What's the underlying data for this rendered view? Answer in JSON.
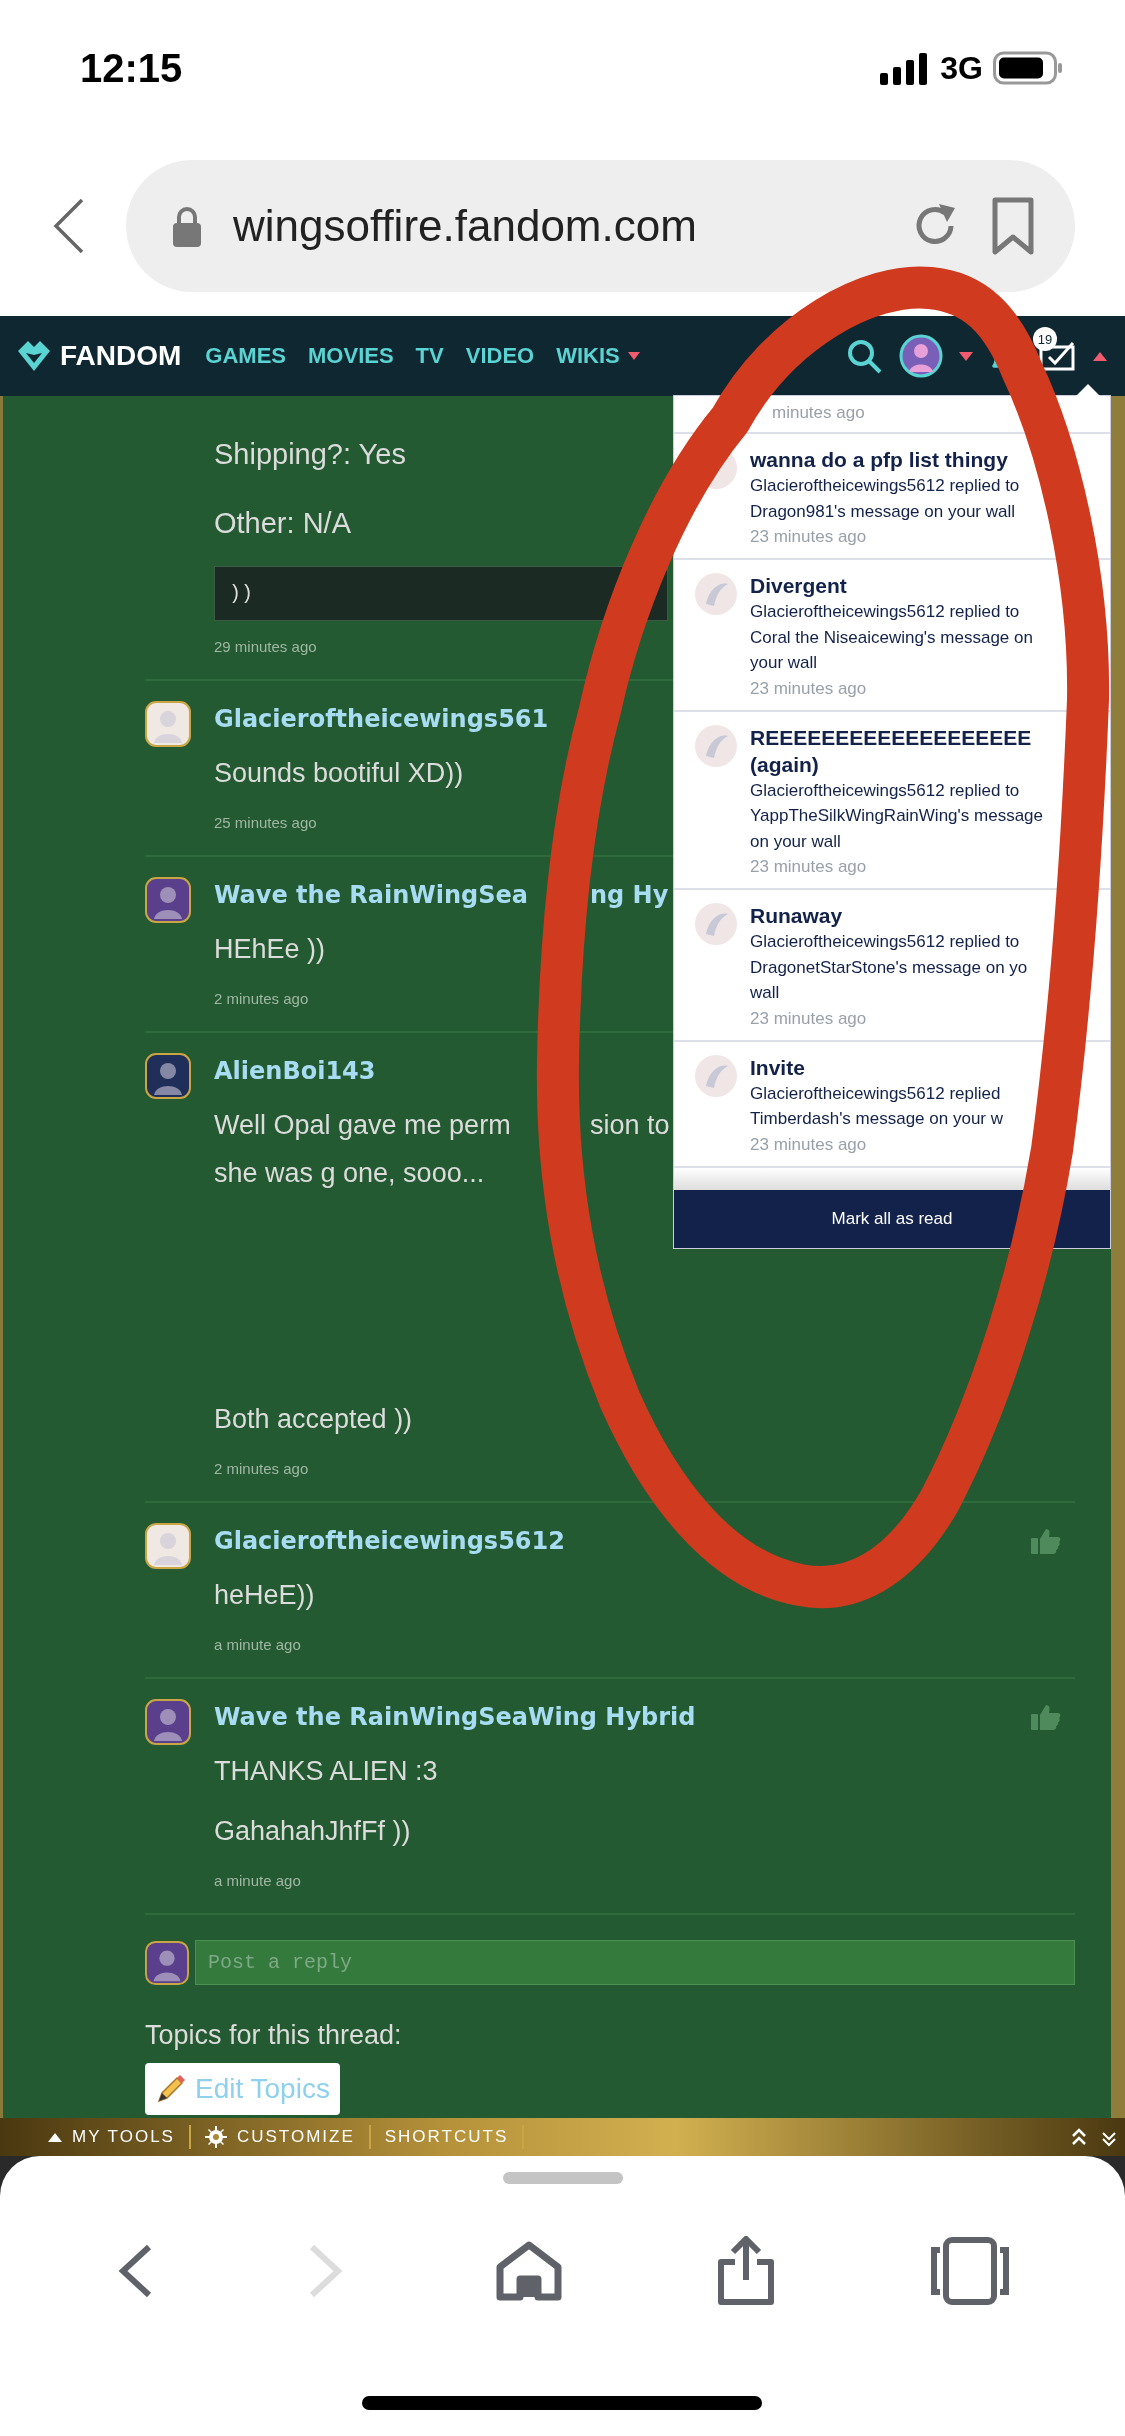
{
  "status_bar": {
    "time": "12:15",
    "network": "3G"
  },
  "browser": {
    "url": "wingsoffire.fandom.com",
    "forward_disabled": true
  },
  "nav": {
    "logo": "FANDOM",
    "links": [
      {
        "label": "GAMES",
        "dropdown": false
      },
      {
        "label": "MOVIES",
        "dropdown": false
      },
      {
        "label": "TV",
        "dropdown": false
      },
      {
        "label": "VIDEO",
        "dropdown": false
      },
      {
        "label": "WIKIS",
        "dropdown": true
      }
    ],
    "message_count": "19"
  },
  "thread": {
    "intro_lines": [
      "Shipping?: Yes",
      "Other: N/A"
    ],
    "code": "))",
    "intro_time": "29 minutes ago",
    "posts": [
      {
        "author": [
          "Glacieroftheicewings561"
        ],
        "color": "#efe8e3",
        "like_button": false,
        "body": [
          {
            "kind": "text",
            "lines": [
              [
                "Sounds bootiful XD))"
              ]
            ]
          }
        ],
        "time": "25 minutes ago"
      },
      {
        "author": [
          "Wave the RainWingSea",
          "ng Hy"
        ],
        "color": "#5a3f8c",
        "like_button": false,
        "body": [
          {
            "kind": "text",
            "lines": [
              [
                "HEhEe ))"
              ]
            ]
          }
        ],
        "time": "2 minutes ago"
      },
      {
        "author": [
          "AlienBoi143"
        ],
        "color": "#1f2f5a",
        "like_button": false,
        "body": [
          {
            "kind": "text",
            "lines": [
              [
                "Well Opal gave me perm",
                "sion to"
              ],
              [
                "she was g one, sooo..."
              ]
            ]
          },
          {
            "kind": "spacer"
          },
          {
            "kind": "text",
            "lines": [
              [
                "Both accepted ))"
              ]
            ]
          }
        ],
        "time": "2 minutes ago"
      },
      {
        "author": [
          "Glacieroftheicewings5612"
        ],
        "color": "#efe8e3",
        "like_button": true,
        "body": [
          {
            "kind": "text",
            "lines": [
              [
                "heHeE))"
              ]
            ]
          }
        ],
        "time": "a minute ago"
      },
      {
        "author": [
          "Wave the RainWingSeaWing Hybrid"
        ],
        "color": "#5a3f8c",
        "like_button": true,
        "body": [
          {
            "kind": "text",
            "lines": [
              [
                "THANKS ALIEN :3"
              ]
            ]
          },
          {
            "kind": "text",
            "lines": [
              [
                "GahahahJhfFf ))"
              ]
            ]
          }
        ],
        "time": "a minute ago"
      }
    ],
    "reply": {
      "placeholder": "Post a reply"
    },
    "topics": {
      "label": "Topics for this thread:",
      "button": "Edit Topics"
    }
  },
  "notifications": {
    "items": [
      {
        "time": "minutes ago"
      },
      {
        "title": "wanna do a pfp list thingy",
        "lines": [
          "Glacieroftheicewings5612 replied to",
          "Dragon981's message on your wall"
        ],
        "time": "23 minutes ago"
      },
      {
        "title": "Divergent",
        "lines": [
          "Glacieroftheicewings5612 replied to",
          "Coral the Niseaicewing's message on",
          "your wall"
        ],
        "time": "23 minutes ago"
      },
      {
        "title": "REEEEEEEEEEEEEEEEEEE (again)",
        "lines": [
          "Glacieroftheicewings5612 replied to",
          "YappTheSilkWingRainWing's message",
          "on your wall"
        ],
        "time": "23 minutes ago"
      },
      {
        "title": "Runaway",
        "lines": [
          "Glacieroftheicewings5612 replied to",
          "DragonetStarStone's message on yo",
          "wall"
        ],
        "time": "23 minutes ago"
      },
      {
        "title": "Invite",
        "lines": [
          "Glacieroftheicewings5612 replied",
          "Timberdash's message on your w"
        ],
        "time": "23 minutes ago"
      }
    ],
    "mark_all": "Mark all as read"
  },
  "toolbar": {
    "items": [
      {
        "label": "MY TOOLS",
        "kind": "caret"
      },
      {
        "label": "CUSTOMIZE",
        "kind": "gear"
      },
      {
        "label": "SHORTCUTS",
        "kind": "plain"
      }
    ]
  }
}
